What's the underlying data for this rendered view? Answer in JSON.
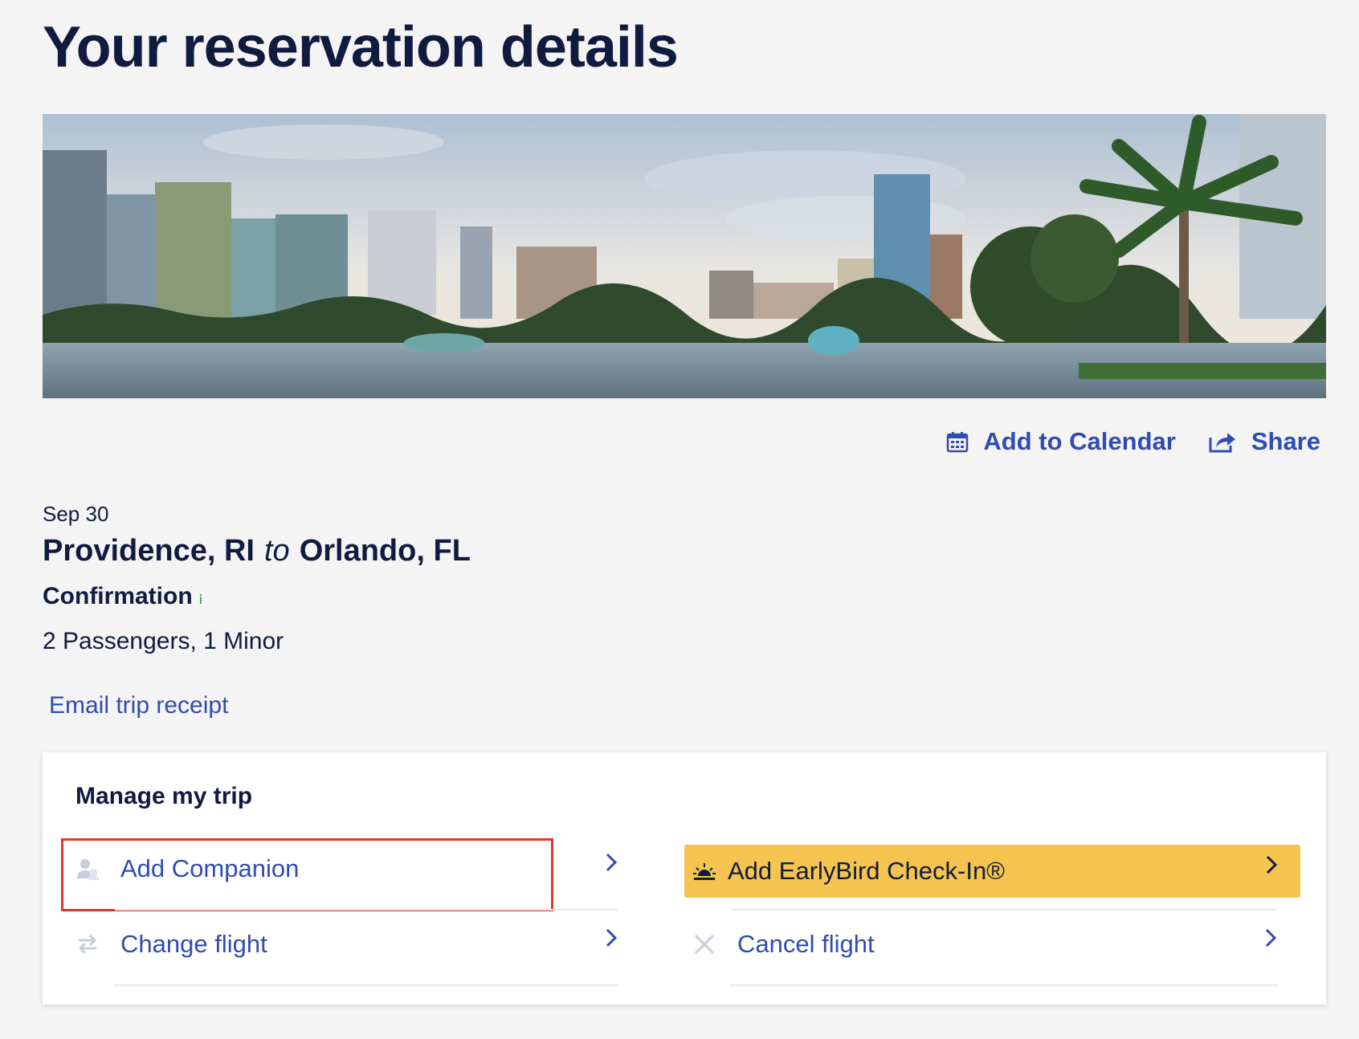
{
  "page": {
    "title": "Your reservation details"
  },
  "hero": {
    "icon": "orlando-skyline-image"
  },
  "actions": {
    "add_to_calendar": "Add to Calendar",
    "share": "Share"
  },
  "trip": {
    "date": "Sep 30",
    "origin": "Providence, RI",
    "connector": "to",
    "destination": "Orlando, FL",
    "confirmation_label": "Confirmation",
    "passengers": "2 Passengers, 1 Minor",
    "email_receipt": "Email trip receipt"
  },
  "manage": {
    "title": "Manage my trip",
    "items": [
      {
        "label": "Add Companion",
        "icon": "companion-icon",
        "highlighted": true
      },
      {
        "label": "Change flight",
        "icon": "swap-arrows-icon"
      },
      {
        "label": "Add EarlyBird Check-In®",
        "icon": "sunrise-icon",
        "accent": "#f4c44f"
      },
      {
        "label": "Cancel flight",
        "icon": "close-icon"
      }
    ]
  },
  "colors": {
    "brand_navy": "#111b40",
    "link_blue": "#304cb2",
    "earlybird_yellow": "#f4c44f",
    "highlight_red": "#e4372a",
    "background": "#f4f4f4"
  }
}
